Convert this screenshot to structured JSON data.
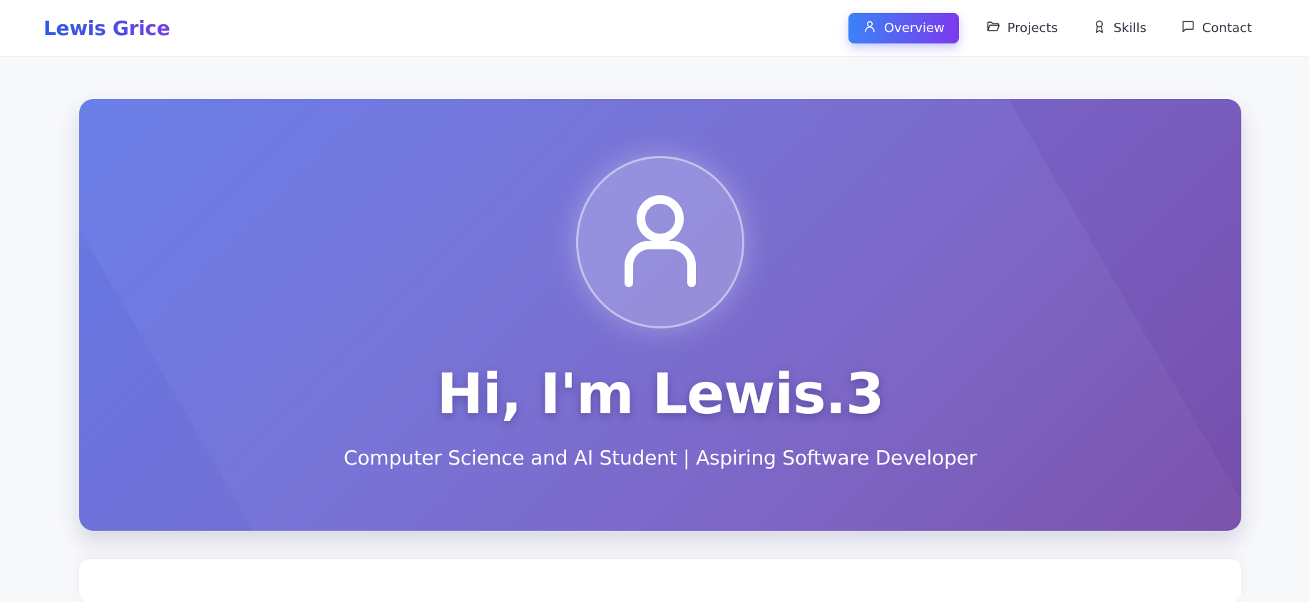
{
  "header": {
    "brand": "Lewis Grice"
  },
  "nav": {
    "items": [
      {
        "label": "Overview",
        "icon": "user-icon",
        "active": true
      },
      {
        "label": "Projects",
        "icon": "folder-icon",
        "active": false
      },
      {
        "label": "Skills",
        "icon": "award-icon",
        "active": false
      },
      {
        "label": "Contact",
        "icon": "message-square-icon",
        "active": false
      }
    ]
  },
  "hero": {
    "avatar_icon": "user-icon",
    "title": "Hi, I'm Lewis.3",
    "subtitle": "Computer Science and AI Student | Aspiring Software Developer"
  },
  "colors": {
    "brand_gradient_start": "#2e5be6",
    "brand_gradient_end": "#7a3fe0",
    "active_nav_start": "#3b82f6",
    "active_nav_end": "#7c3aed",
    "hero_gradient_start": "#6a7fe8",
    "hero_gradient_end": "#7b52ac",
    "page_background": "#f7f8fa"
  }
}
